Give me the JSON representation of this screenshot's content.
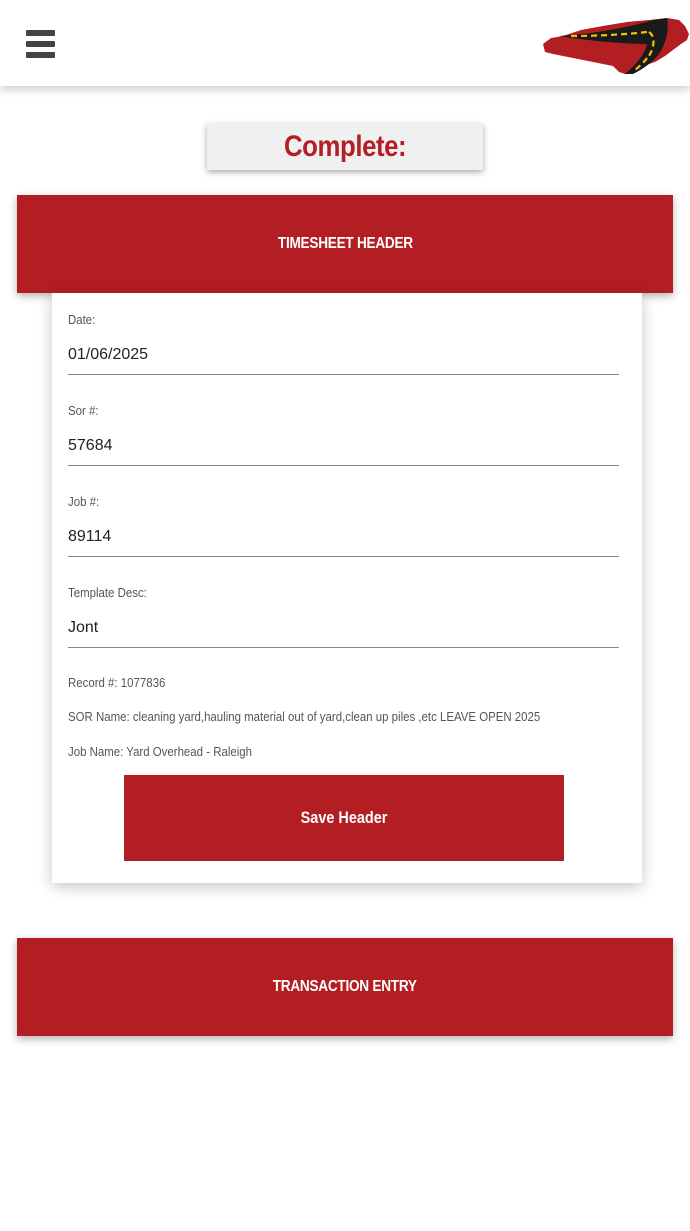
{
  "header": {
    "menu_icon": "hamburger-menu-icon",
    "logo_icon": "nc-road-map-logo"
  },
  "status": {
    "title": "Complete:"
  },
  "sections": {
    "timesheet_header": "TIMESHEET HEADER",
    "transaction_entry": "TRANSACTION ENTRY"
  },
  "form": {
    "date": {
      "label": "Date:",
      "value": "01/06/2025"
    },
    "sor": {
      "label": "Sor #:",
      "value": "57684"
    },
    "job": {
      "label": "Job #:",
      "value": "89114"
    },
    "template": {
      "label": "Template Desc:",
      "value": "Jont"
    },
    "record": "Record #: 1077836",
    "sor_name": "SOR Name: cleaning yard,hauling material out of yard,clean up piles ,etc LEAVE OPEN 2025",
    "job_name": "Job Name: Yard Overhead - Raleigh",
    "save_label": "Save Header"
  },
  "colors": {
    "brand_red": "#b31e22",
    "title_red": "#b21f24",
    "road_black": "#1a1a1a",
    "road_yellow": "#f2c200"
  }
}
